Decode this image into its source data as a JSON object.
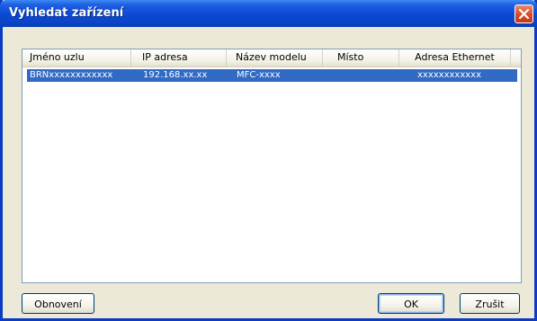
{
  "window": {
    "title": "Vyhledat zařízení"
  },
  "list": {
    "columns": [
      "Jméno uzlu",
      "IP adresa",
      "Název modelu",
      "Místo",
      "Adresa Ethernet"
    ],
    "rows": [
      [
        "BRNxxxxxxxxxxxx",
        "192.168.xx.xx",
        "MFC-xxxx",
        "",
        "xxxxxxxxxxxx"
      ]
    ]
  },
  "buttons": {
    "refresh": "Obnovení",
    "ok": "OK",
    "cancel": "Zrušit"
  },
  "icons": {
    "close": "close-icon"
  },
  "colors": {
    "titlebar": "#0a48d6",
    "selection": "#316ac5",
    "close": "#d84a26"
  }
}
